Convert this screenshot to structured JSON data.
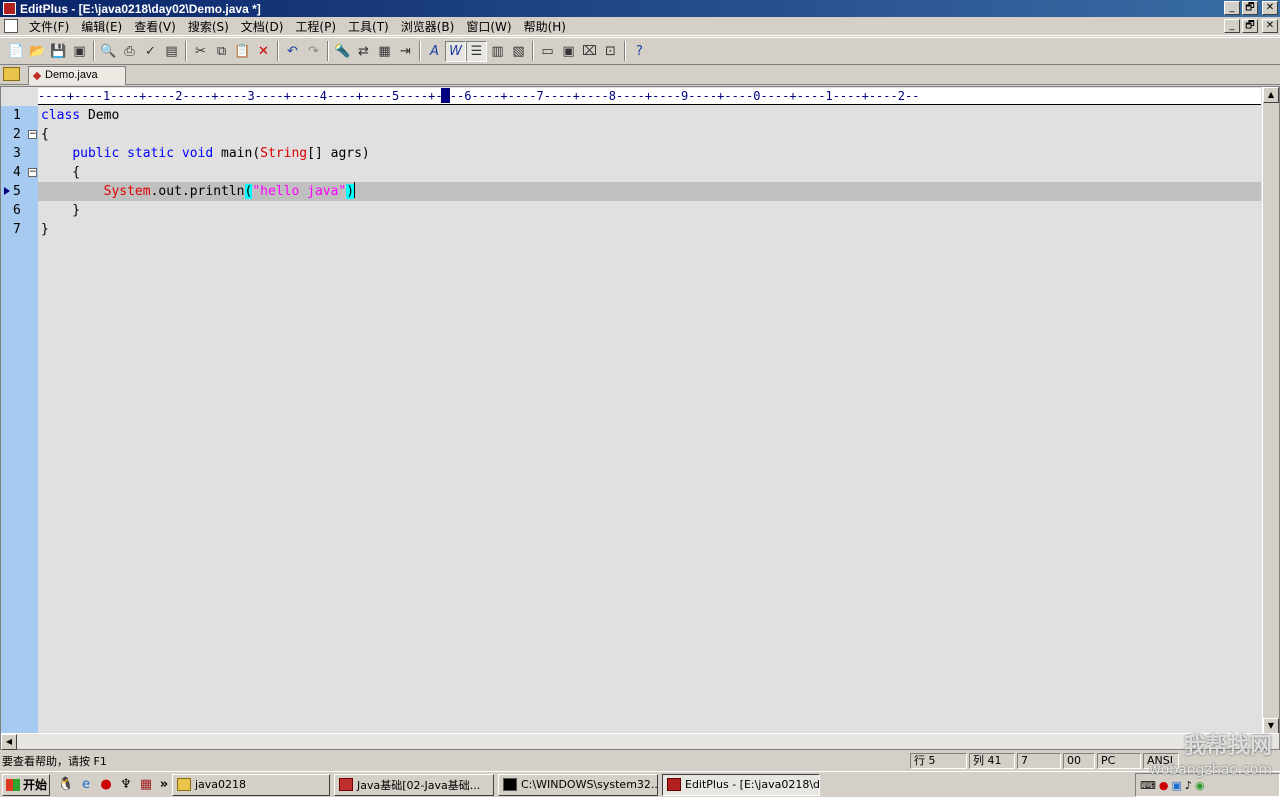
{
  "window": {
    "title": "EditPlus - [E:\\java0218\\day02\\Demo.java *]",
    "minimize": "_",
    "restore": "🗗",
    "close": "✕"
  },
  "menu": {
    "items": [
      "文件(F)",
      "编辑(E)",
      "查看(V)",
      "搜索(S)",
      "文档(D)",
      "工程(P)",
      "工具(T)",
      "浏览器(B)",
      "窗口(W)",
      "帮助(H)"
    ]
  },
  "toolbar": {
    "icons": [
      "new-file-icon",
      "open-icon",
      "save-icon",
      "save-all-icon",
      "print-preview-icon",
      "print-icon",
      "spell-check-icon",
      "page-setup-icon",
      "cut-icon",
      "copy-icon",
      "paste-icon",
      "delete-icon",
      "undo-icon",
      "redo-icon",
      "find-icon",
      "replace-icon",
      "find-in-files-icon",
      "goto-icon",
      "font-icon",
      "word-wrap-icon",
      "indent-icon",
      "column-select-icon",
      "ruler-icon",
      "browser-icon",
      "fullscreen-icon",
      "cliptext-icon",
      "directory-icon",
      "function-list-icon",
      "help-icon"
    ]
  },
  "tabs": [
    {
      "label": "Demo.java",
      "modified": true
    }
  ],
  "editor": {
    "ruler": "----+----1----+----2----+----3----+----4----+----5----+----6----+----7----+----8----+----9----+----0----+----1----+----2--",
    "current_line": 5,
    "lines": [
      {
        "number": "1",
        "text": "class Demo"
      },
      {
        "number": "2",
        "text": "{"
      },
      {
        "number": "3",
        "text": "    public static void main(String[] agrs)"
      },
      {
        "number": "4",
        "text": "    {"
      },
      {
        "number": "5",
        "text": "        System.out.println(\"hello java\")"
      },
      {
        "number": "6",
        "text": "    }"
      },
      {
        "number": "7",
        "text": "}"
      }
    ],
    "tokens": {
      "l1_kw": "class",
      "l1_rest": " Demo",
      "l3_indent": "    ",
      "l3_kw": "public static void",
      "l3_mid": " main(",
      "l3_cls": "String",
      "l3_rest": "[] agrs)",
      "l5_indent": "        ",
      "l5_cls": "System",
      "l5_mid": ".out.println",
      "l5_open": "(",
      "l5_str": "\"hello java\"",
      "l5_close": ")"
    }
  },
  "status": {
    "help_text": "要查看帮助，请按 F1",
    "line": "行 5",
    "col": "列 41",
    "c3": "7",
    "c4": "00",
    "mode": "PC",
    "encoding": "ANSI"
  },
  "taskbar": {
    "start": "开始",
    "more": "»",
    "tasks": [
      {
        "label": "java0218"
      },
      {
        "label": "Java基础[02-Java基础..."
      },
      {
        "label": "C:\\WINDOWS\\system32..."
      },
      {
        "label": "EditPlus - [E:\\java0218\\d..."
      }
    ]
  },
  "watermark": {
    "brand": "我帮找网",
    "url": "wobangzhao.com"
  },
  "colors": {
    "keyword": "#0000ff",
    "class": "#e00000",
    "string": "#ff00ff",
    "gutter": "#a6caf0",
    "titlebar": "#0a246a"
  }
}
